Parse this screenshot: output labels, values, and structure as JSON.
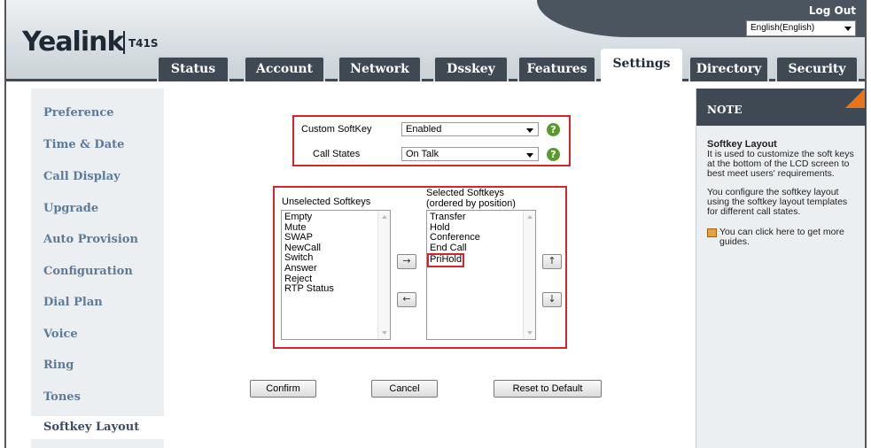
{
  "header": {
    "logo_text": "Yealink",
    "model": "T41S",
    "logout": "Log Out",
    "language": "English(English)"
  },
  "tabs": [
    {
      "label": "Status"
    },
    {
      "label": "Account"
    },
    {
      "label": "Network"
    },
    {
      "label": "Dsskey"
    },
    {
      "label": "Features"
    },
    {
      "label": "Settings",
      "active": true
    },
    {
      "label": "Directory"
    },
    {
      "label": "Security"
    }
  ],
  "sidebar": {
    "items": [
      {
        "label": "Preference"
      },
      {
        "label": "Time & Date"
      },
      {
        "label": "Call Display"
      },
      {
        "label": "Upgrade"
      },
      {
        "label": "Auto Provision"
      },
      {
        "label": "Configuration"
      },
      {
        "label": "Dial Plan"
      },
      {
        "label": "Voice"
      },
      {
        "label": "Ring"
      },
      {
        "label": "Tones"
      },
      {
        "label": "Softkey Layout",
        "active": true
      }
    ]
  },
  "form": {
    "custom_softkey_label": "Custom SoftKey",
    "custom_softkey_value": "Enabled",
    "call_states_label": "Call States",
    "call_states_value": "On Talk",
    "help_glyph": "?",
    "unselected_title": "Unselected Softkeys",
    "selected_title_line1": "Selected Softkeys",
    "selected_title_line2": "(ordered by position)",
    "unselected_items": [
      "Empty",
      "Mute",
      "SWAP",
      "NewCall",
      "Switch",
      "Answer",
      "Reject",
      "RTP Status"
    ],
    "selected_items": [
      "Transfer",
      "Hold",
      "Conference",
      "End Call",
      "PriHold"
    ],
    "move_right": "→",
    "move_left": "←",
    "move_up": "↑",
    "move_down": "↓",
    "confirm": "Confirm",
    "cancel": "Cancel",
    "reset": "Reset to Default"
  },
  "note": {
    "heading": "NOTE",
    "title": "Softkey Layout",
    "text1": "It is used to customize the soft keys at the bottom of the LCD screen to best meet users' requirements.",
    "text2": "You configure the softkey layout using the softkey layout templates for different call states.",
    "guide": "You can click here to get more guides."
  },
  "colors": {
    "accent_dark": "#3e4954",
    "sidebar_link": "#5d7a99",
    "highlight_red": "#d6242c",
    "help_green": "#5a9a2c",
    "note_corner": "#e8741b"
  }
}
